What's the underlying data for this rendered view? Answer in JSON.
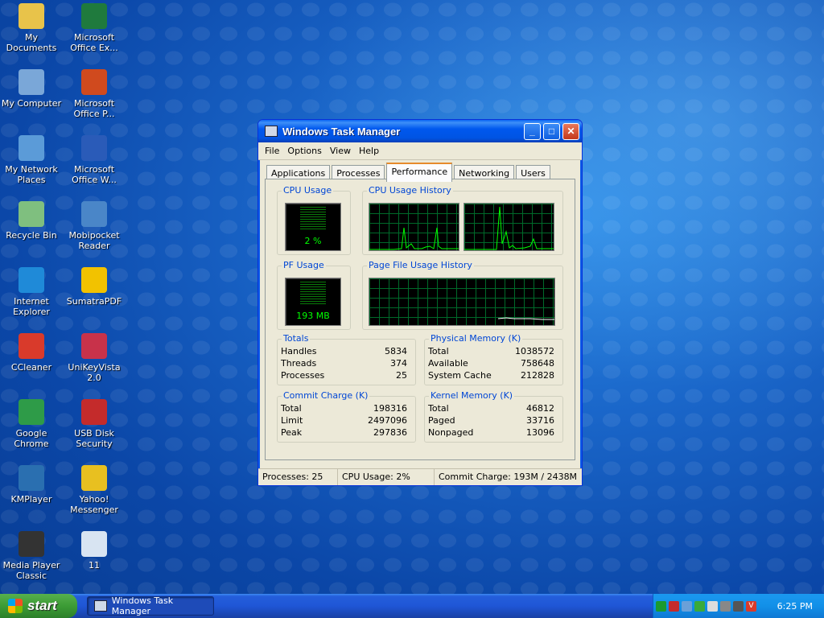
{
  "desktop": {
    "icons": [
      {
        "label": "My Documents",
        "icon": "folder-documents-icon",
        "color": "#e8c34a"
      },
      {
        "label": "Microsoft Office Ex...",
        "icon": "excel-icon",
        "color": "#1f7a3d"
      },
      {
        "label": "My Computer",
        "icon": "computer-icon",
        "color": "#7aa7d8"
      },
      {
        "label": "Microsoft Office P...",
        "icon": "powerpoint-icon",
        "color": "#d04a1e"
      },
      {
        "label": "My Network Places",
        "icon": "network-icon",
        "color": "#5b9bd8"
      },
      {
        "label": "Microsoft Office W...",
        "icon": "word-icon",
        "color": "#2a5bb8"
      },
      {
        "label": "Recycle Bin",
        "icon": "recycle-bin-icon",
        "color": "#7fbf7f"
      },
      {
        "label": "Mobipocket Reader",
        "icon": "mobipocket-icon",
        "color": "#4a86c8"
      },
      {
        "label": "Internet Explorer",
        "icon": "internet-explorer-icon",
        "color": "#1f8ad8"
      },
      {
        "label": "SumatraPDF",
        "icon": "sumatra-pdf-icon",
        "color": "#f2c200"
      },
      {
        "label": "CCleaner",
        "icon": "ccleaner-icon",
        "color": "#d93a2b"
      },
      {
        "label": "UniKeyVista 2.0",
        "icon": "unikey-icon",
        "color": "#c8324a"
      },
      {
        "label": "Google Chrome",
        "icon": "chrome-icon",
        "color": "#2e9b48"
      },
      {
        "label": "USB Disk Security",
        "icon": "shield-icon",
        "color": "#c42b2b"
      },
      {
        "label": "KMPlayer",
        "icon": "kmplayer-icon",
        "color": "#2a6fb0"
      },
      {
        "label": "Yahoo! Messenger",
        "icon": "yahoo-messenger-icon",
        "color": "#e8c020"
      },
      {
        "label": "Media Player Classic",
        "icon": "media-player-icon",
        "color": "#333333"
      },
      {
        "label": "11",
        "icon": "document-icon",
        "color": "#d8e4f2"
      }
    ]
  },
  "window": {
    "title": "Windows Task Manager",
    "menu": [
      "File",
      "Options",
      "View",
      "Help"
    ],
    "tabs": [
      "Applications",
      "Processes",
      "Performance",
      "Networking",
      "Users"
    ],
    "active_tab": "Performance",
    "cpu_usage": {
      "label": "CPU Usage",
      "value": "2 %",
      "percent": 2
    },
    "cpu_history": {
      "label": "CPU Usage History"
    },
    "pf_usage": {
      "label": "PF Usage",
      "value": "193 MB"
    },
    "pf_history": {
      "label": "Page File Usage History"
    },
    "totals": {
      "label": "Totals",
      "rows": [
        {
          "k": "Handles",
          "v": "5834"
        },
        {
          "k": "Threads",
          "v": "374"
        },
        {
          "k": "Processes",
          "v": "25"
        }
      ]
    },
    "physical_memory": {
      "label": "Physical Memory (K)",
      "rows": [
        {
          "k": "Total",
          "v": "1038572"
        },
        {
          "k": "Available",
          "v": "758648"
        },
        {
          "k": "System Cache",
          "v": "212828"
        }
      ]
    },
    "commit_charge": {
      "label": "Commit Charge (K)",
      "rows": [
        {
          "k": "Total",
          "v": "198316"
        },
        {
          "k": "Limit",
          "v": "2497096"
        },
        {
          "k": "Peak",
          "v": "297836"
        }
      ]
    },
    "kernel_memory": {
      "label": "Kernel Memory (K)",
      "rows": [
        {
          "k": "Total",
          "v": "46812"
        },
        {
          "k": "Paged",
          "v": "33716"
        },
        {
          "k": "Nonpaged",
          "v": "13096"
        }
      ]
    },
    "status": {
      "processes": "Processes: 25",
      "cpu": "CPU Usage: 2%",
      "commit": "Commit Charge: 193M / 2438M"
    }
  },
  "taskbar": {
    "start_label": "start",
    "task_label": "Windows Task Manager",
    "clock": "6:25 PM",
    "tray_icons": [
      "network-icon",
      "shield-icon",
      "monitor-icon",
      "update-icon",
      "messenger-icon",
      "speaker-icon",
      "volume-icon",
      "antivirus-icon"
    ]
  },
  "colors": {
    "accent": "#0054e3",
    "graph_line": "#00ff00",
    "grid": "#006a2a",
    "group_label": "#0046d5"
  }
}
